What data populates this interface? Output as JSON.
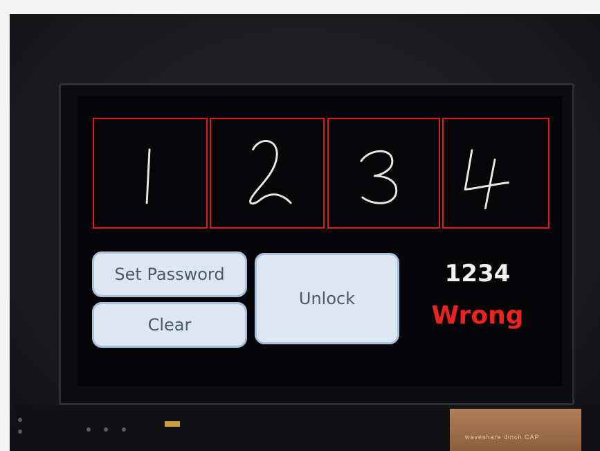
{
  "app": {
    "digits": [
      "1",
      "2",
      "3",
      "4"
    ],
    "buttons": {
      "set_password": "Set Password",
      "clear": "Clear",
      "unlock": "Unlock"
    },
    "entered_code": "1234",
    "status": "Wrong"
  },
  "colors": {
    "digit_box_border": "#e01a1a",
    "status_wrong": "#f0221e",
    "button_fill": "#dde7f2",
    "button_border": "#a9c1db"
  },
  "device_label": "waveshare 4inch CAP"
}
